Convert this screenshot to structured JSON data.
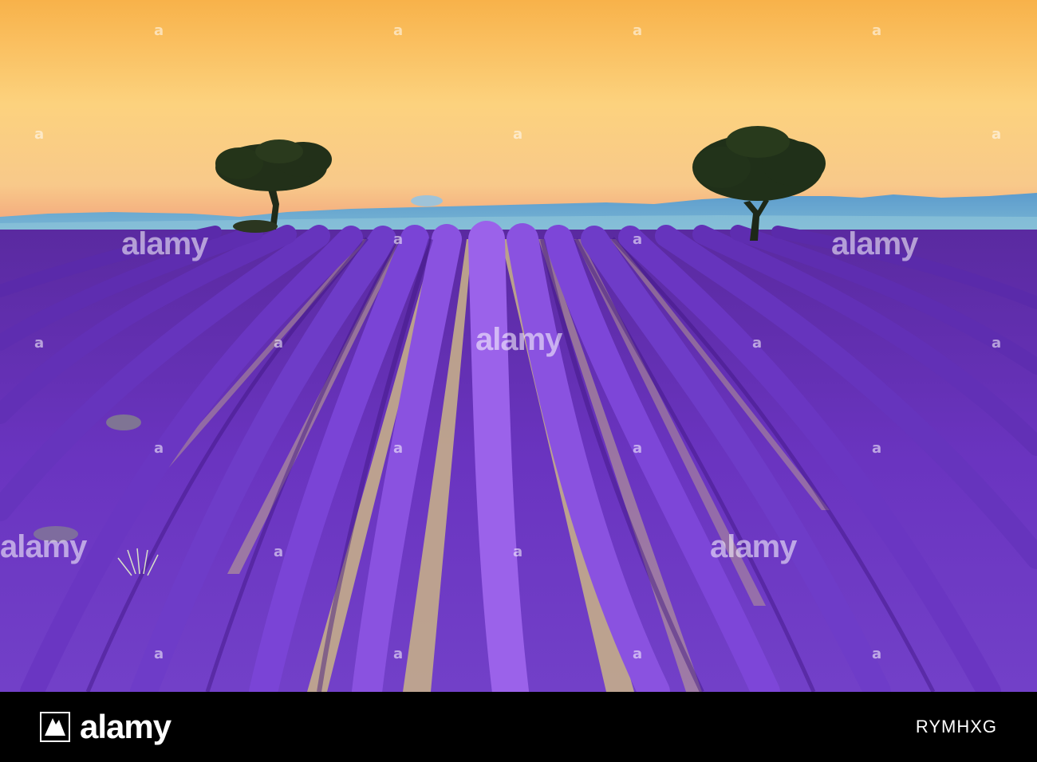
{
  "watermark": {
    "brand": "alamy",
    "image_id": "RYMHXG",
    "tile_text": "a"
  },
  "colors": {
    "sky_top": "#f7b955",
    "sky_mid": "#fcd98a",
    "sky_horizon": "#f4a56a",
    "hills": "#5a9ec7",
    "lavender_dark": "#4a1a8c",
    "lavender_light": "#8a4ee0",
    "path_soil": "#c9b08a",
    "tree_silhouette": "#1d2a1a",
    "bar_background": "#000000",
    "bar_text": "#ffffff"
  }
}
